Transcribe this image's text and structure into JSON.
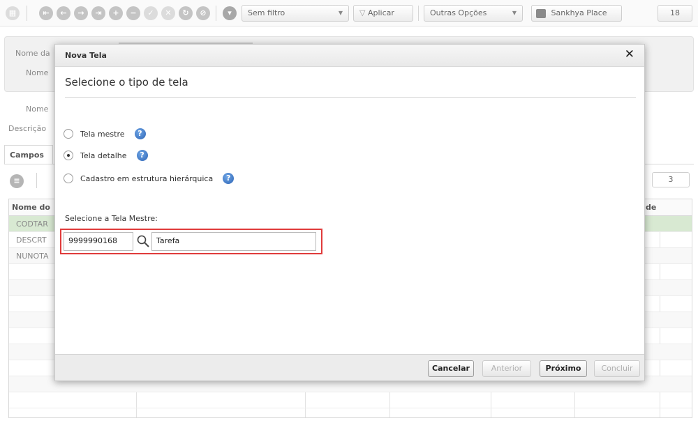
{
  "toolbar": {
    "sem_filtro": "Sem filtro",
    "aplicar": "Aplicar",
    "outras_opcoes": "Outras Opções",
    "sankhya_place": "Sankhya Place",
    "counter": "18"
  },
  "background": {
    "nome_da_prefix": "Nome da",
    "nome_prefix_1": "Nome",
    "nome_prefix_2": "Nome",
    "descricao_prefix": "Descrição",
    "tab_campos": "Campos",
    "grid_header_first": "Nome do",
    "grid_header_last": "de",
    "grid_counter": "3",
    "rows": [
      "CODTAR",
      "DESCRT",
      "NUNOTA"
    ]
  },
  "modal": {
    "title": "Nova Tela",
    "subtitle": "Selecione o tipo de tela",
    "options": [
      {
        "label": "Tela mestre",
        "checked": false
      },
      {
        "label": "Tela detalhe",
        "checked": true
      },
      {
        "label": "Cadastro em estrutura hierárquica",
        "checked": false
      }
    ],
    "mestre_label": "Selecione a Tela Mestre:",
    "mestre_code": "9999990168",
    "mestre_desc": "Tarefa",
    "buttons": {
      "cancelar": "Cancelar",
      "anterior": "Anterior",
      "proximo": "Próximo",
      "concluir": "Concluir"
    }
  },
  "colors": {
    "highlight": "#e03b3b",
    "selected_row": "#d8e9d2",
    "help_icon": "#2d64b5"
  }
}
